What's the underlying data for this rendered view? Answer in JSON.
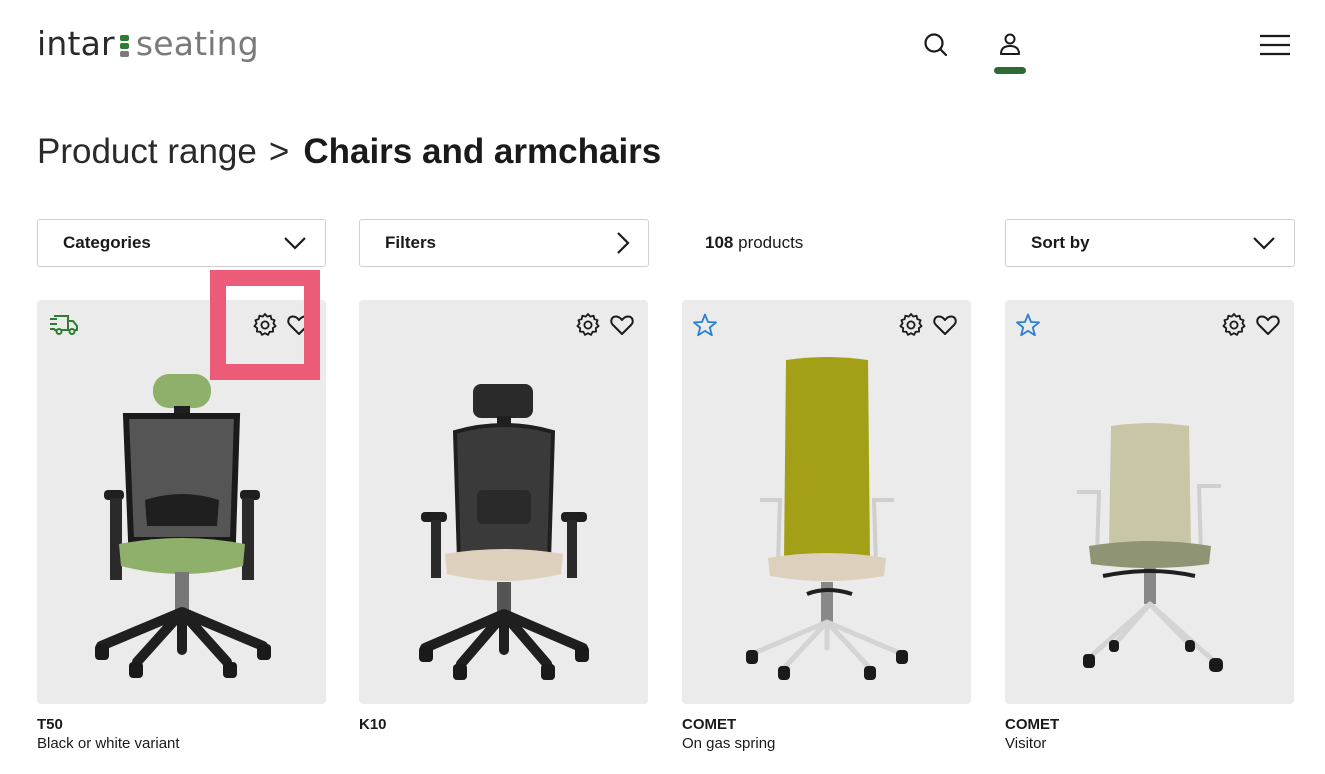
{
  "header": {
    "logo_word1": "intar",
    "logo_word2": "seating",
    "search_icon": "search-icon",
    "account_icon": "user-icon",
    "menu_icon": "hamburger-menu-icon",
    "accent_color": "#2e6b34"
  },
  "breadcrumb": {
    "parent": "Product range",
    "separator": ">",
    "current": "Chairs and armchairs"
  },
  "toolbar": {
    "categories_label": "Categories",
    "filters_label": "Filters",
    "count_number": "108",
    "count_suffix": "products",
    "sort_label": "Sort by"
  },
  "products": [
    {
      "name": "T50",
      "description": "Black or white variant",
      "badge_icon": "delivery-truck-icon"
    },
    {
      "name": "K10",
      "description": "",
      "badge_icon": ""
    },
    {
      "name": "COMET",
      "description": "On gas spring",
      "badge_icon": "star-icon"
    },
    {
      "name": "COMET",
      "description": "Visitor",
      "badge_icon": "star-icon"
    }
  ],
  "highlight_color": "#ec5b78"
}
